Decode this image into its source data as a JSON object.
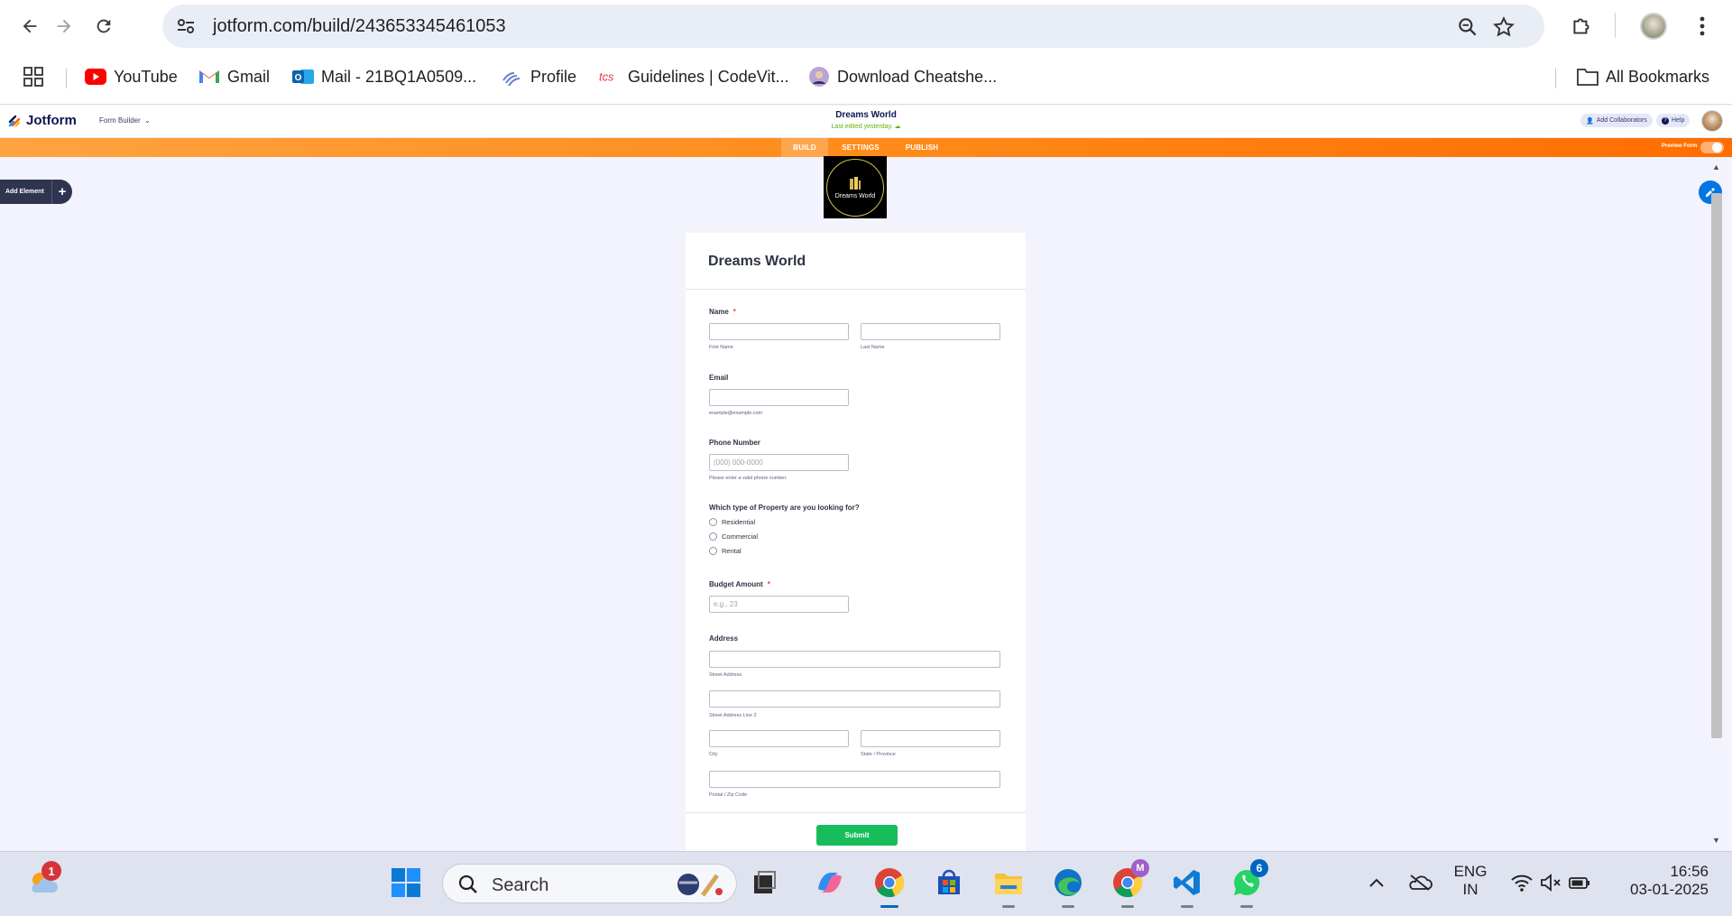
{
  "browser": {
    "url": "jotform.com/build/243653345461053",
    "bookmarks": [
      {
        "label": "YouTube",
        "icon": "youtube-icon"
      },
      {
        "label": "Gmail",
        "icon": "gmail-icon"
      },
      {
        "label": "Mail - 21BQ1A0509...",
        "icon": "outlook-icon"
      },
      {
        "label": "Profile",
        "icon": "profile-icon"
      },
      {
        "label": "Guidelines | CodeVit...",
        "icon": "tcs-icon"
      },
      {
        "label": "Download Cheatshe...",
        "icon": "avatar-icon"
      }
    ],
    "all_bookmarks": "All Bookmarks"
  },
  "jotform": {
    "brand": "Jotform",
    "form_builder": "Form Builder",
    "form_title": "Dreams World",
    "last_edited": "Last edited yesterday.",
    "add_collaborators": "Add Collaborators",
    "help": "Help",
    "tabs": [
      "BUILD",
      "SETTINGS",
      "PUBLISH"
    ],
    "active_tab": "BUILD",
    "preview_form": "Preview Form",
    "add_element": "Add Element",
    "colors": {
      "orange_start": "#ffa340",
      "orange_end": "#ff6d00",
      "submit": "#18bd5b",
      "accent": "#0075e3"
    }
  },
  "logo": {
    "line1": "Dreams World"
  },
  "form": {
    "title": "Dreams World",
    "name_label": "Name",
    "first_name": "First Name",
    "last_name": "Last Name",
    "email_label": "Email",
    "email_sub": "example@example.com",
    "phone_label": "Phone Number",
    "phone_placeholder": "(000) 000-0000",
    "phone_sub": "Please enter a valid phone number.",
    "property_label": "Which type of Property are you looking for?",
    "property_options": [
      "Residential",
      "Commercial",
      "Rental"
    ],
    "budget_label": "Budget Amount",
    "budget_placeholder": "e.g., 23",
    "address_label": "Address",
    "street": "Street Address",
    "street2": "Street Address Line 2",
    "city": "City",
    "state": "State / Province",
    "postal": "Postal / Zip Code",
    "submit": "Submit",
    "required": "*"
  },
  "taskbar": {
    "search_text": "Search",
    "weather_badge": "1",
    "chrome2_badge": "M",
    "whatsapp_badge": "6",
    "lang_line1": "ENG",
    "lang_line2": "IN",
    "time": "16:56",
    "date": "03-01-2025"
  }
}
